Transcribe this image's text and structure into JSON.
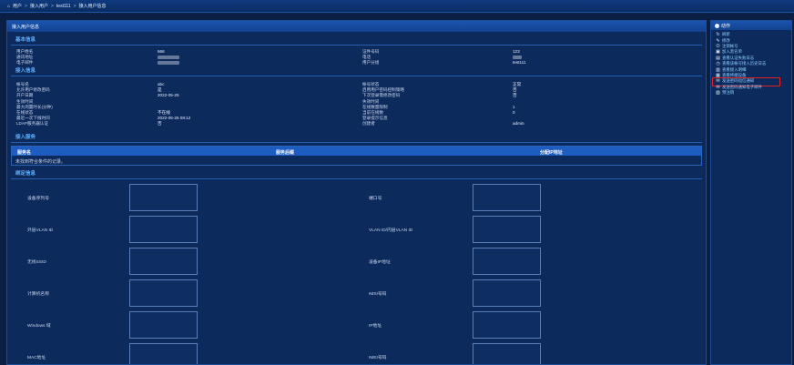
{
  "breadcrumb": {
    "icon": "home-icon",
    "items": [
      "用户",
      "接入用户",
      "test111",
      "接入用户信息"
    ]
  },
  "panel_title": "接入用户信息",
  "sections": {
    "basic": "基本信息",
    "access": "接入信息",
    "services": "接入服务",
    "binding": "绑定信息"
  },
  "basic_info": [
    {
      "l1": "用户姓名",
      "v1": "666",
      "l2": "证件号码",
      "v2": "123"
    },
    {
      "l1": "通讯地址",
      "v1": "",
      "l2": "电话",
      "v2": ""
    },
    {
      "l1": "电子邮件",
      "v1": "",
      "l2": "用户分组",
      "v2": "test111"
    }
  ],
  "access_info": [
    {
      "l1": "帐号名",
      "v1": "abc",
      "l2": "帐号状态",
      "v2": "正常"
    },
    {
      "l1": "允许用户修改密码",
      "v1": "是",
      "l2": "启用用户密码控制策略",
      "v2": "否"
    },
    {
      "l1": "开户日期",
      "v1": "2022-05-25",
      "l2": "下次登录需修改密码",
      "v2": "否"
    },
    {
      "l1": "生效时间",
      "v1": "",
      "l2": "失效时间",
      "v2": ""
    },
    {
      "l1": "最大闲置时长(分钟)",
      "v1": "",
      "l2": "在线数量限制",
      "v2": "1"
    },
    {
      "l1": "在线状态",
      "v1": "不在线",
      "l2": "当前在线数",
      "v2": "0"
    },
    {
      "l1": "最近一次下线时间",
      "v1": "2022-05-25 08:12",
      "l2": "登录提示信息",
      "v2": ""
    },
    {
      "l1": "LDAP服务器认证",
      "v1": "否",
      "l2": "创建者",
      "v2": "admin"
    }
  ],
  "services_table": {
    "headers": [
      "服务名",
      "服务后缀",
      "分配IP地址"
    ],
    "empty_text": "未找到符合条件的记录。"
  },
  "binding_fields": [
    {
      "l1": "设备序列号",
      "l2": "端口号"
    },
    {
      "l1": "外层VLAN ID",
      "l2": "VLAN ID/内层VLAN ID"
    },
    {
      "l1": "无线SSID",
      "l2": "设备IP地址"
    },
    {
      "l1": "计算机名称",
      "l2": "IMSI号码"
    },
    {
      "l1": "Windows 域",
      "l2": "IP地址"
    },
    {
      "l1": "MAC地址",
      "l2": "IMEI号码"
    }
  ],
  "actions": {
    "title": "动作",
    "items": [
      {
        "icon": "refresh-icon",
        "glyph": "↻",
        "label": "刷新"
      },
      {
        "icon": "edit-icon",
        "glyph": "✎",
        "label": "修改"
      },
      {
        "icon": "power-icon",
        "glyph": "⏻",
        "label": "注销帐号"
      },
      {
        "icon": "blacklist-icon",
        "glyph": "▣",
        "label": "加入黑名单"
      },
      {
        "icon": "auth-log-icon",
        "glyph": "▤",
        "label": "查看认证失败日志"
      },
      {
        "icon": "history-icon",
        "glyph": "◷",
        "label": "查看该帐号接入历史日志"
      },
      {
        "icon": "online-icon",
        "glyph": "▥",
        "label": "查看接入明细"
      },
      {
        "icon": "device-icon",
        "glyph": "▦",
        "label": "查看终端设备"
      },
      {
        "icon": "sms-password-icon",
        "glyph": "✉",
        "label": "发送密码短信通知"
      },
      {
        "icon": "email-password-icon",
        "glyph": "✉",
        "label": "发送密码通知电子邮件"
      },
      {
        "icon": "cancel-account-icon",
        "glyph": "▧",
        "label": "预注销"
      }
    ],
    "highlighted_index": 8
  }
}
